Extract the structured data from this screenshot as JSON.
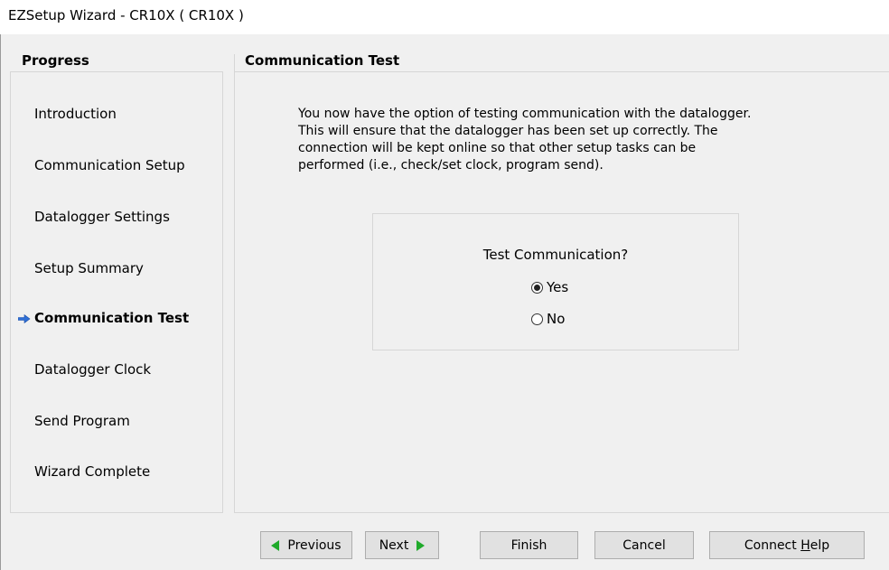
{
  "window": {
    "title": "EZSetup Wizard - CR10X ( CR10X )"
  },
  "sidebar": {
    "header": "Progress",
    "steps": [
      {
        "label": "Introduction",
        "current": false
      },
      {
        "label": "Communication Setup",
        "current": false
      },
      {
        "label": "Datalogger Settings",
        "current": false
      },
      {
        "label": "Setup Summary",
        "current": false
      },
      {
        "label": "Communication Test",
        "current": true
      },
      {
        "label": "Datalogger Clock",
        "current": false
      },
      {
        "label": "Send Program",
        "current": false
      },
      {
        "label": "Wizard Complete",
        "current": false
      }
    ],
    "current_indicator_icon": "right-arrow-icon"
  },
  "main": {
    "title": "Communication Test",
    "description": "You now have the option of testing communication with the datalogger.\n This will ensure that the datalogger has been set up correctly.  The\nconnection will be kept online so that other setup tasks can be\nperformed (i.e., check/set clock, program send).",
    "test_group": {
      "label": "Test Communication?",
      "options": [
        {
          "label": "Yes",
          "selected": true
        },
        {
          "label": "No",
          "selected": false
        }
      ]
    }
  },
  "buttons": {
    "previous": "Previous",
    "next": "Next",
    "finish": "Finish",
    "cancel": "Cancel",
    "help_prefix": "Connect ",
    "help_underlined": "H",
    "help_suffix": "elp"
  },
  "colors": {
    "nav_arrow": "#1faa2a",
    "indicator_arrow": "#2f6fd6"
  }
}
